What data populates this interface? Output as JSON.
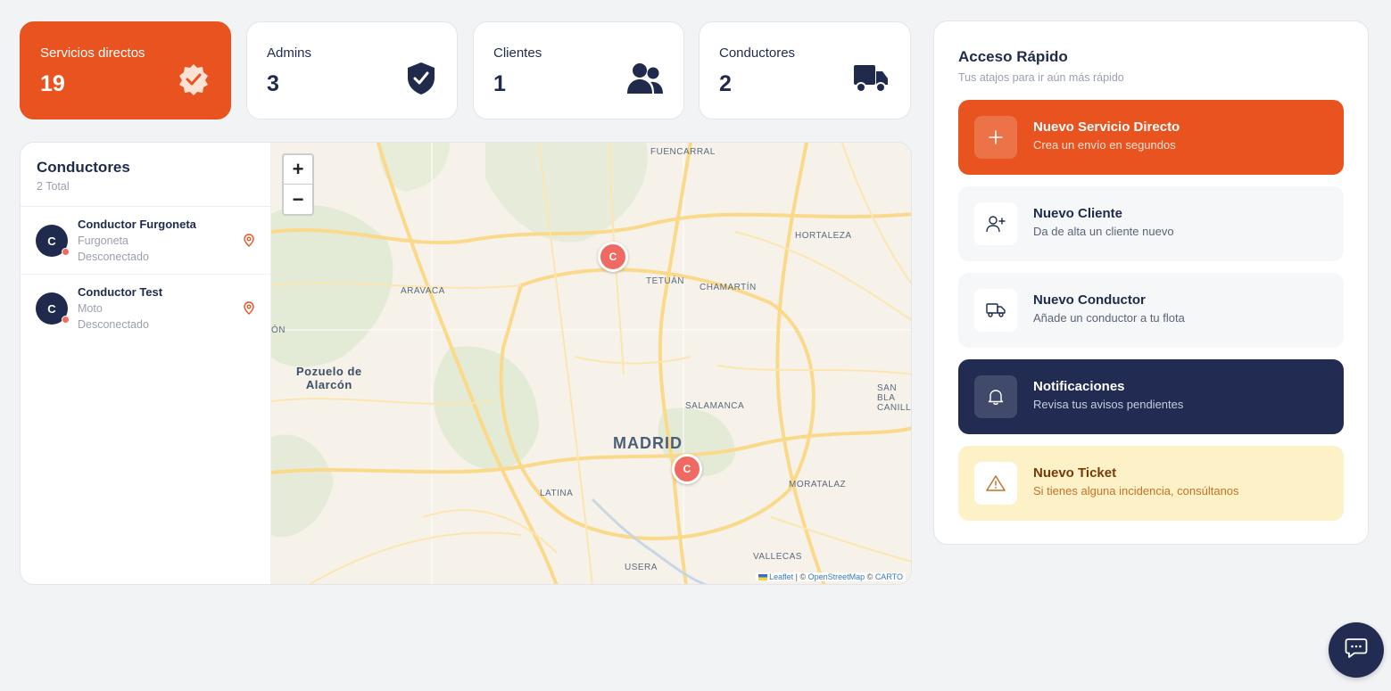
{
  "stats": [
    {
      "label": "Servicios directos",
      "value": "19",
      "icon": "badge-check-icon",
      "accent": "#e8531f"
    },
    {
      "label": "Admins",
      "value": "3",
      "icon": "shield-check-icon"
    },
    {
      "label": "Clientes",
      "value": "1",
      "icon": "users-icon"
    },
    {
      "label": "Conductores",
      "value": "2",
      "icon": "truck-icon"
    }
  ],
  "drivers": {
    "title": "Conductores",
    "subtitle": "2 Total",
    "items": [
      {
        "initial": "C",
        "name": "Conductor Furgoneta",
        "vehicle": "Furgoneta",
        "status": "Desconectado"
      },
      {
        "initial": "C",
        "name": "Conductor Test",
        "vehicle": "Moto",
        "status": "Desconectado"
      }
    ]
  },
  "map": {
    "zoom_in": "+",
    "zoom_out": "−",
    "labels": {
      "fuencarral": "FUENCARRAL",
      "hortaleza": "HORTALEZA",
      "tetuan": "TETUÁN",
      "chamartin": "CHAMARTÍN",
      "aravaca": "ARAVACA",
      "pozuelo1": "Pozuelo de",
      "pozuelo2": "Alarcón",
      "salamanca": "SALAMANCA",
      "madrid": "MADRID",
      "sanblas1": "SAN BLA",
      "sanblas2": "CANILLE",
      "latina": "LATINA",
      "moratalaz": "MORATALAZ",
      "usera": "USERA",
      "vallecas": "VALLECAS",
      "edge": "ÓN"
    },
    "markers": [
      "C",
      "C"
    ],
    "attribution": {
      "leaflet": "Leaflet",
      "sep1": " | © ",
      "osm": "OpenStreetMap",
      "sep2": " © ",
      "carto": "CARTO"
    }
  },
  "quick_access": {
    "title": "Acceso Rápido",
    "subtitle": "Tus atajos para ir aún más rápido",
    "items": [
      {
        "name": "Nuevo Servicio Directo",
        "desc": "Crea un envío en segundos",
        "icon": "plus-icon"
      },
      {
        "name": "Nuevo Cliente",
        "desc": "Da de alta un cliente nuevo",
        "icon": "user-plus-icon"
      },
      {
        "name": "Nuevo Conductor",
        "desc": "Añade un conductor a tu flota",
        "icon": "truck-icon"
      },
      {
        "name": "Notificaciones",
        "desc": "Revisa tus avisos pendientes",
        "icon": "bell-icon"
      },
      {
        "name": "Nuevo Ticket",
        "desc": "Si tienes alguna incidencia, consúltanos",
        "icon": "warning-icon"
      }
    ]
  },
  "chat": {
    "icon": "chat-icon"
  }
}
